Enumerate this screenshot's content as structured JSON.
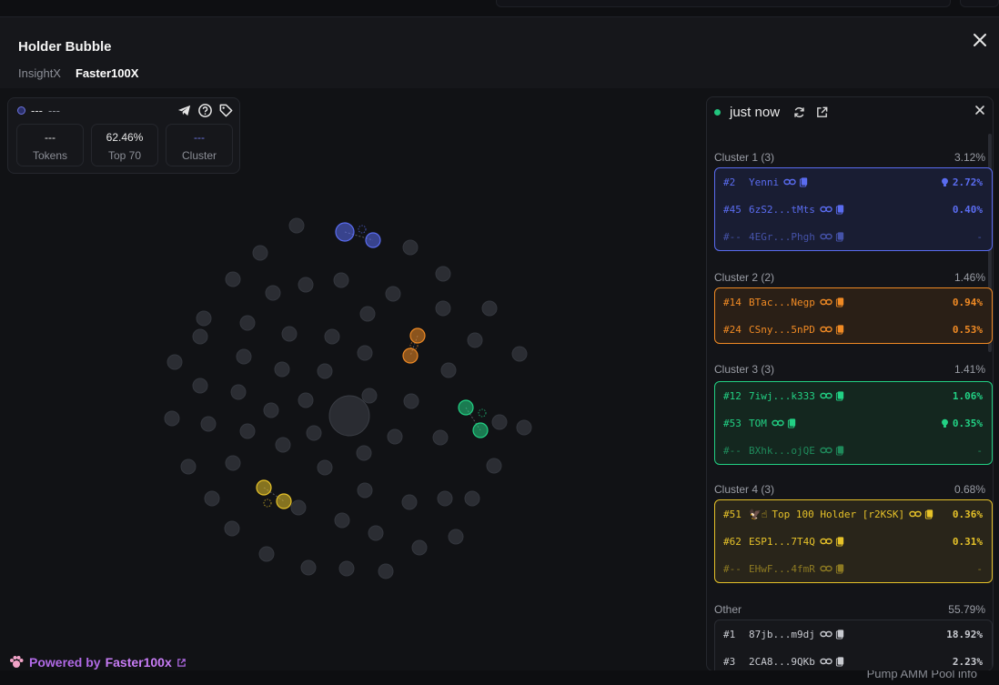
{
  "modal": {
    "title": "Holder Bubble",
    "tabs": [
      {
        "label": "InsightX",
        "active": false
      },
      {
        "label": "Faster100X",
        "active": true
      }
    ]
  },
  "stats": {
    "label": "---",
    "sublabel": "---",
    "boxes": [
      {
        "value": "---",
        "label": "Tokens"
      },
      {
        "value": "62.46%",
        "label": "Top 70"
      },
      {
        "value": "---",
        "label": "Cluster"
      }
    ]
  },
  "powered": {
    "prefix": "Powered by",
    "brand": "Faster100x"
  },
  "panel": {
    "updated": "just now",
    "clusters": [
      {
        "title": "Cluster 1 (3)",
        "pct": "3.12%",
        "color": "#5a6cf0",
        "rows": [
          {
            "rank": "#2",
            "name": "Yenni",
            "pct": "2.72%",
            "bulb": true
          },
          {
            "rank": "#45",
            "name": "6zS2...tMts",
            "pct": "0.40%",
            "bulb": false
          },
          {
            "rank": "#--",
            "name": "4EGr...Phgh",
            "pct": "-",
            "bulb": false,
            "dim": true
          }
        ]
      },
      {
        "title": "Cluster 2 (2)",
        "pct": "1.46%",
        "color": "#f08a24",
        "rows": [
          {
            "rank": "#14",
            "name": "BTac...Negp",
            "pct": "0.94%",
            "bulb": false
          },
          {
            "rank": "#24",
            "name": "CSny...5nPD",
            "pct": "0.53%",
            "bulb": false
          }
        ]
      },
      {
        "title": "Cluster 3 (3)",
        "pct": "1.41%",
        "color": "#22d184",
        "rows": [
          {
            "rank": "#12",
            "name": "7iwj...k333",
            "pct": "1.06%",
            "bulb": false
          },
          {
            "rank": "#53",
            "name": "TOM",
            "pct": "0.35%",
            "bulb": true
          },
          {
            "rank": "#--",
            "name": "BXhk...ojQE",
            "pct": "-",
            "bulb": false,
            "dim": true
          }
        ]
      },
      {
        "title": "Cluster 4 (3)",
        "pct": "0.68%",
        "color": "#e6c229",
        "rows": [
          {
            "rank": "#51",
            "name": "Top 100 Holder [r2KSK]",
            "pct": "0.36%",
            "bulb": false,
            "emoji": "🦅☝"
          },
          {
            "rank": "#62",
            "name": "ESP1...7T4Q",
            "pct": "0.31%",
            "bulb": false
          },
          {
            "rank": "#--",
            "name": "EHwF...4fmR",
            "pct": "-",
            "bulb": false,
            "dim": true
          }
        ]
      },
      {
        "title": "Other",
        "pct": "55.79%",
        "color": "#9a9da5",
        "rows": [
          {
            "rank": "#1",
            "name": "87jb...m9dj",
            "pct": "18.92%",
            "bulb": false
          },
          {
            "rank": "#3",
            "name": "2CA8...9QKb",
            "pct": "2.23%",
            "bulb": false
          }
        ]
      }
    ]
  },
  "bottom_bar": {
    "right_label": "Pump AMM Pool info"
  },
  "colors": {
    "cluster1": "#5a6cf0",
    "cluster2": "#f08a24",
    "cluster3": "#22d184",
    "cluster4": "#e6c229",
    "accent_purple": "#b16ae6",
    "bubble_gray": "#2b2d33"
  }
}
